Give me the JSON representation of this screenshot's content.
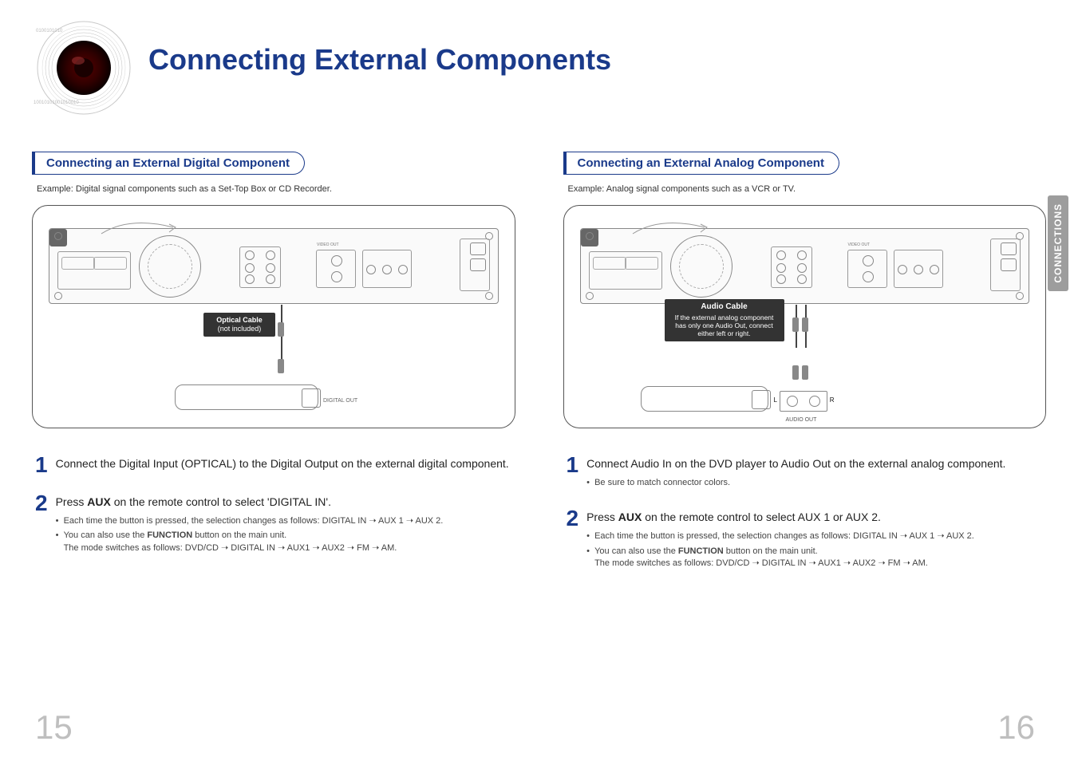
{
  "header": {
    "title": "Connecting External Components"
  },
  "side_tab": "CONNECTIONS",
  "left": {
    "heading": "Connecting an External Digital Component",
    "example": "Example: Digital signal components such as a Set-Top Box or CD Recorder.",
    "callout_line1": "Optical Cable",
    "callout_line2": "(not included)",
    "ext_label": "DIGITAL OUT",
    "step1": "Connect the Digital Input (OPTICAL) to the Digital Output on the external digital component.",
    "step2_lead_a": "Press ",
    "step2_lead_bold": "AUX",
    "step2_lead_b": " on the remote control to select 'DIGITAL IN'.",
    "step2_b1": "Each time the button is pressed, the selection changes as follows: DIGITAL IN ➝ AUX 1 ➝ AUX 2.",
    "step2_b2a": "You can also use the ",
    "step2_b2bold": "FUNCTION",
    "step2_b2b": " button on the main unit.",
    "step2_b3": "The mode switches as follows: DVD/CD ➝ DIGITAL IN ➝ AUX1 ➝ AUX2 ➝ FM ➝ AM."
  },
  "right": {
    "heading": "Connecting an External Analog Component",
    "example": "Example: Analog signal components such as a VCR or TV.",
    "callout_title": "Audio Cable",
    "callout_body": "If the external analog component has only one Audio Out, connect either left or right.",
    "ana_label": "AUDIO OUT",
    "step1": "Connect Audio In on the DVD player to Audio Out on the external analog component.",
    "step1_b1": "Be sure to match connector colors.",
    "step2_lead_a": "Press ",
    "step2_lead_bold": "AUX",
    "step2_lead_b": " on the remote control to select AUX 1 or AUX 2.",
    "step2_b1": "Each time the button is pressed, the selection changes as follows: DIGITAL IN ➝ AUX 1 ➝ AUX 2.",
    "step2_b2a": "You can also use the ",
    "step2_b2bold": "FUNCTION",
    "step2_b2b": " button on the main unit.",
    "step2_b3": "The mode switches as follows: DVD/CD ➝ DIGITAL IN ➝ AUX1 ➝ AUX2 ➝ FM ➝ AM."
  },
  "page_left": "15",
  "page_right": "16"
}
